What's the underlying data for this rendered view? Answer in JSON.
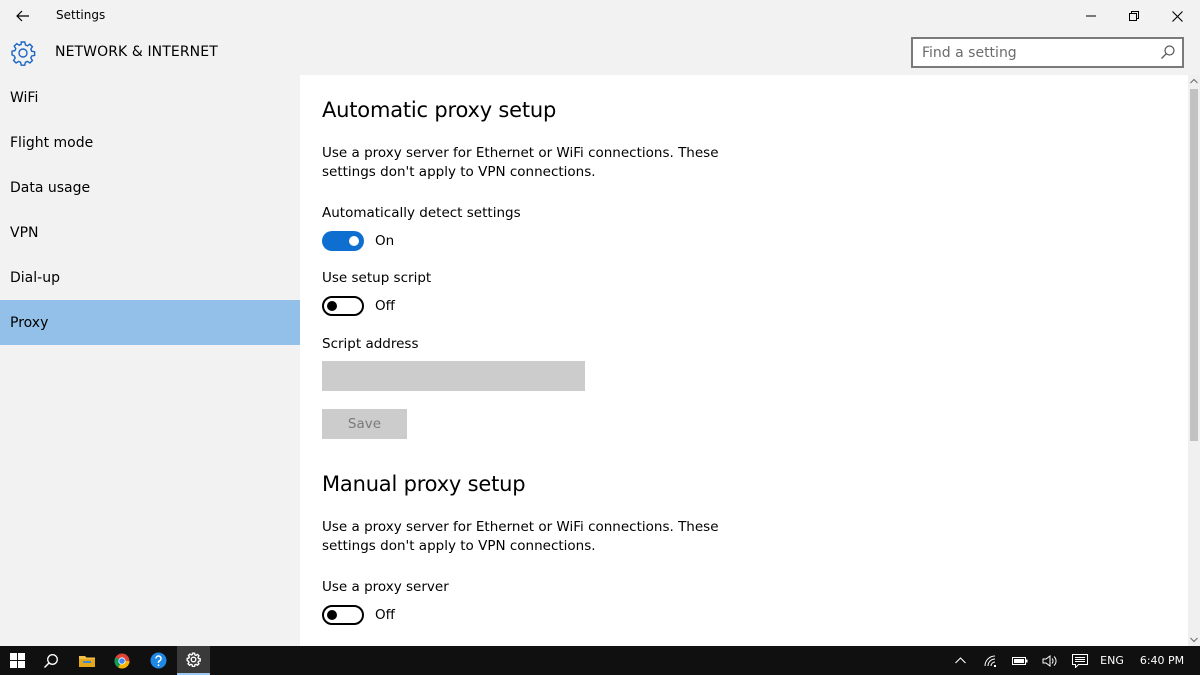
{
  "window": {
    "title": "Settings"
  },
  "header": {
    "section_title": "NETWORK & INTERNET",
    "search_placeholder": "Find a setting"
  },
  "sidebar": {
    "items": [
      {
        "label": "WiFi",
        "selected": false
      },
      {
        "label": "Flight mode",
        "selected": false
      },
      {
        "label": "Data usage",
        "selected": false
      },
      {
        "label": "VPN",
        "selected": false
      },
      {
        "label": "Dial-up",
        "selected": false
      },
      {
        "label": "Proxy",
        "selected": true
      }
    ]
  },
  "automatic": {
    "heading": "Automatic proxy setup",
    "description": "Use a proxy server for Ethernet or WiFi connections. These settings don't apply to VPN connections.",
    "detect_label": "Automatically detect settings",
    "detect_state": "On",
    "script_label": "Use setup script",
    "script_state": "Off",
    "address_label": "Script address",
    "address_value": "",
    "save_label": "Save"
  },
  "manual": {
    "heading": "Manual proxy setup",
    "description": "Use a proxy server for Ethernet or WiFi connections. These settings don't apply to VPN connections.",
    "use_proxy_label": "Use a proxy server",
    "use_proxy_state": "Off"
  },
  "taskbar": {
    "language": "ENG",
    "time": "6:40 PM"
  },
  "colors": {
    "accent": "#0f6fd0",
    "selected_nav": "#93c0e9",
    "taskbar": "#101010"
  }
}
